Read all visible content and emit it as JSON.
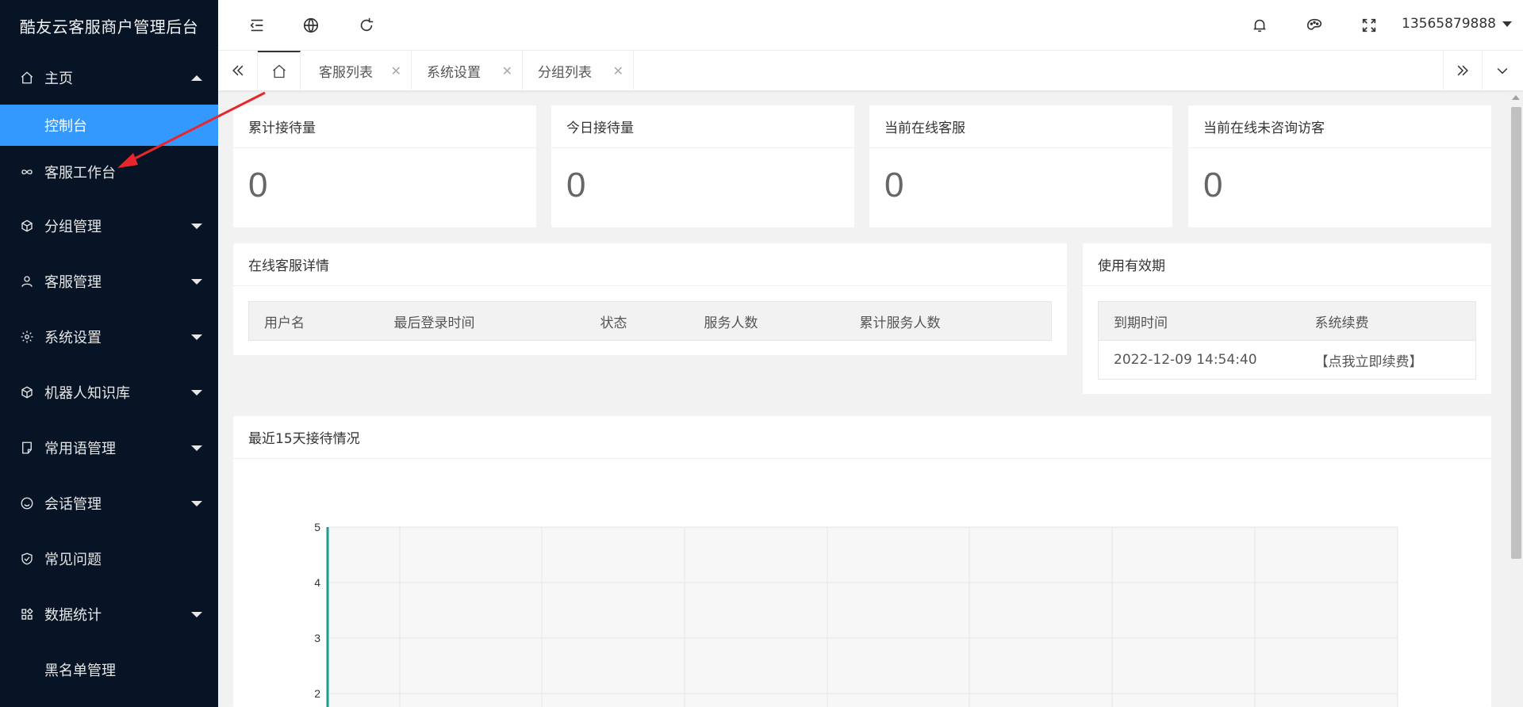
{
  "sidebar": {
    "title": "酷友云客服商户管理后台",
    "home": {
      "label": "主页",
      "icon": "home-icon"
    },
    "home_sub": "控制台",
    "items": [
      {
        "label": "客服工作台",
        "icon": "infinity-icon",
        "caret": false
      },
      {
        "label": "分组管理",
        "icon": "cube-icon",
        "caret": true
      },
      {
        "label": "客服管理",
        "icon": "user-icon",
        "caret": true
      },
      {
        "label": "系统设置",
        "icon": "gear-icon",
        "caret": true
      },
      {
        "label": "机器人知识库",
        "icon": "cube-icon",
        "caret": true
      },
      {
        "label": "常用语管理",
        "icon": "note-icon",
        "caret": true
      },
      {
        "label": "会话管理",
        "icon": "smile-icon",
        "caret": true
      },
      {
        "label": "常见问题",
        "icon": "shield-icon",
        "caret": false
      },
      {
        "label": "数据统计",
        "icon": "grid-icon",
        "caret": true
      },
      {
        "label": "黑名单管理",
        "icon": "",
        "caret": false
      }
    ]
  },
  "header": {
    "username": "13565879888"
  },
  "tabs": [
    {
      "label": "客服列表"
    },
    {
      "label": "系统设置"
    },
    {
      "label": "分组列表"
    }
  ],
  "stats": [
    {
      "title": "累计接待量",
      "value": "0"
    },
    {
      "title": "今日接待量",
      "value": "0"
    },
    {
      "title": "当前在线客服",
      "value": "0"
    },
    {
      "title": "当前在线未咨询访客",
      "value": "0"
    }
  ],
  "online_panel": {
    "title": "在线客服详情",
    "columns": [
      "用户名",
      "最后登录时间",
      "状态",
      "服务人数",
      "累计服务人数"
    ]
  },
  "validity_panel": {
    "title": "使用有效期",
    "columns": [
      "到期时间",
      "系统续费"
    ],
    "expire": "2022-12-09 14:54:40",
    "renew": "【点我立即续费】"
  },
  "chart_panel": {
    "title": "最近15天接待情况"
  },
  "chart_data": {
    "type": "line",
    "title": "最近15天接待情况",
    "y_ticks": [
      "5",
      "4",
      "3",
      "2"
    ],
    "ylim": [
      0,
      5
    ],
    "grid": true,
    "series": []
  },
  "colors": {
    "sidebar_bg": "#061426",
    "active": "#3399ff",
    "renew": "#ff0000",
    "axis": "#1a9e8f"
  }
}
